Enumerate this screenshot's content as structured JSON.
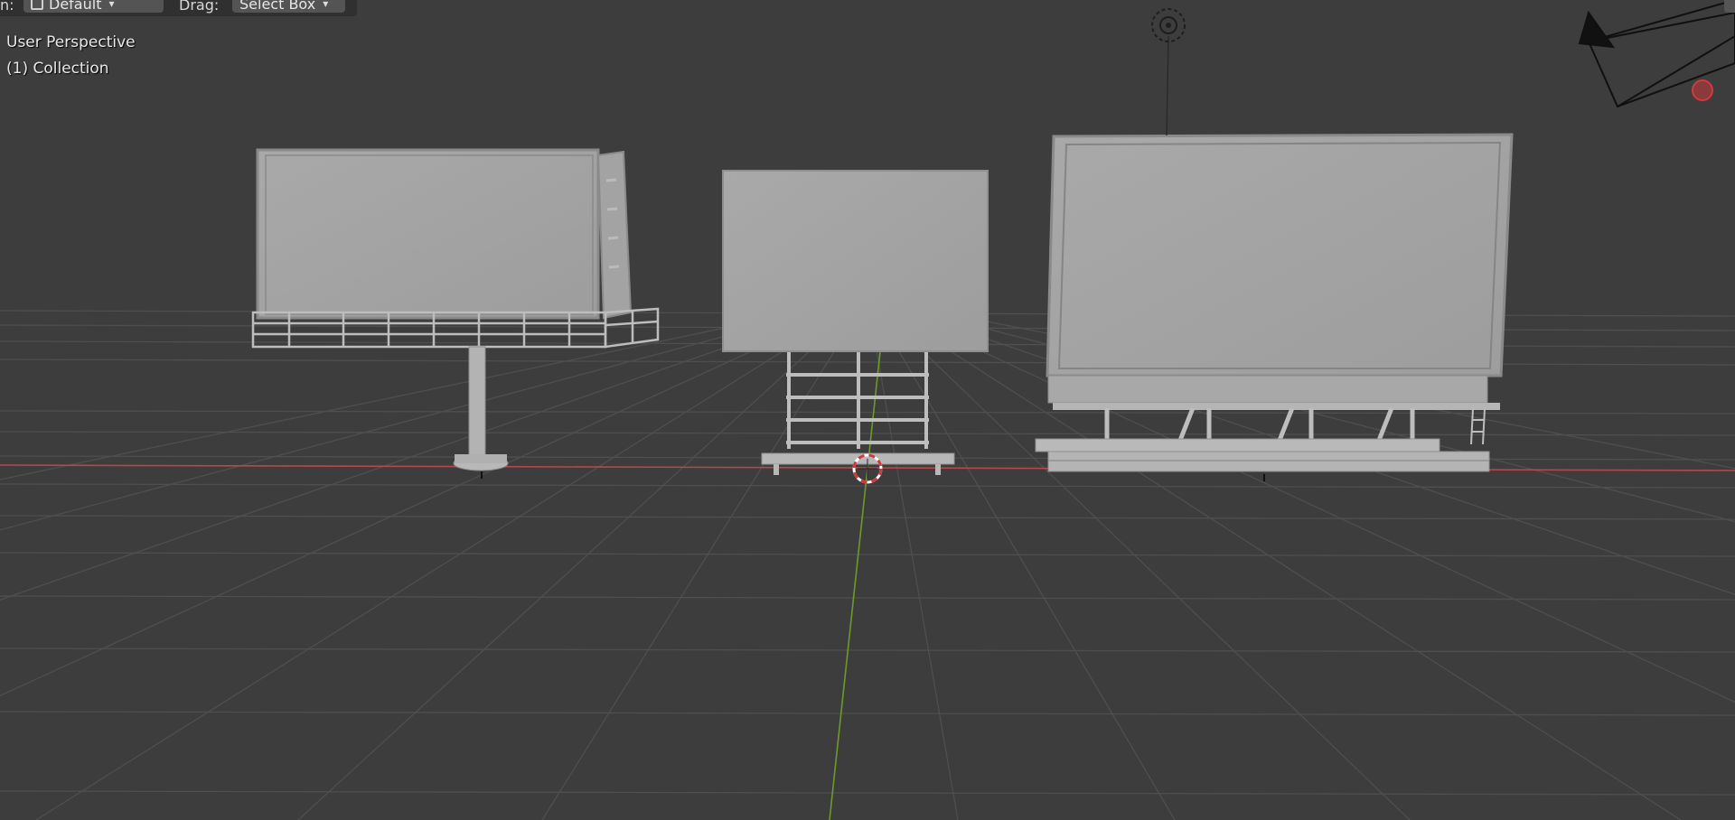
{
  "header": {
    "orientation_label": "n:",
    "orientation_value": "Default",
    "drag_label": "Drag:",
    "drag_value": "Select Box"
  },
  "viewport": {
    "view_name": "User Perspective",
    "collection_label": "(1) Collection"
  },
  "colors": {
    "background": "#3d3d3d",
    "grid": "#4f4f4f",
    "x_axis": "#b8474b",
    "y_axis": "#6d9a2a",
    "mesh": "#a6a6a6",
    "cursor_red": "#d23a3a"
  },
  "icons": [
    "transform-orientation-icon",
    "chevron-down-icon",
    "light-icon",
    "camera-icon",
    "3d-cursor-icon"
  ]
}
